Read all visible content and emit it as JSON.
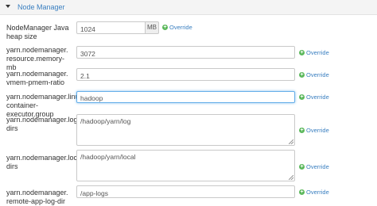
{
  "panel": {
    "title": "Node Manager"
  },
  "override_label": "Override",
  "rows": [
    {
      "label": "NodeManager Java heap size",
      "value": "1024",
      "unit": "MB"
    },
    {
      "label": "yarn.nodemanager.\nresource.memory-mb",
      "value": "3072"
    },
    {
      "label": "yarn.nodemanager.\nvmem-pmem-ratio",
      "value": "2.1"
    },
    {
      "label": "yarn.nodemanager.linux-\ncontainer-executor.group",
      "value": "hadoop"
    },
    {
      "label": "yarn.nodemanager.log-\ndirs",
      "value": "/hadoop/yarn/log"
    },
    {
      "label": "yarn.nodemanager.local-\ndirs",
      "value": "/hadoop/yarn/local"
    },
    {
      "label": "yarn.nodemanager.\nremote-app-log-dir",
      "value": "/app-logs"
    }
  ]
}
